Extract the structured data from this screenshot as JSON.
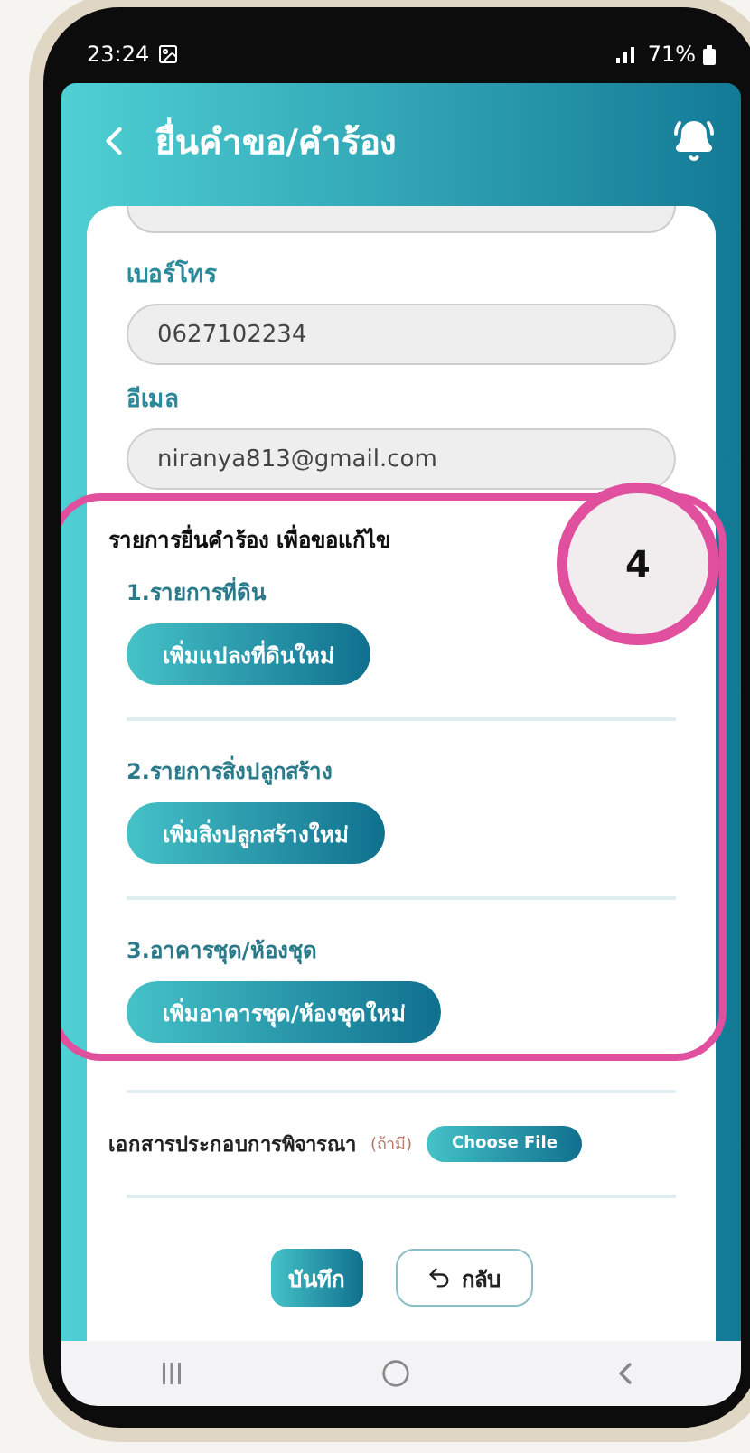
{
  "status_bar": {
    "time": "23:24",
    "battery": "71%"
  },
  "header": {
    "title": "ยื่นคำขอ/คำร้อง"
  },
  "form": {
    "fields": [
      {
        "label": "เบอร์โทร",
        "value": "0627102234"
      },
      {
        "label": "อีเมล",
        "value": "niranya813@gmail.com"
      }
    ],
    "section_title": "รายการยื่นคำร้อง เพื่อขอแก้ไข",
    "groups": [
      {
        "title": "1.รายการที่ดิน",
        "button": "เพิ่มแปลงที่ดินใหม่"
      },
      {
        "title": "2.รายการสิ่งปลูกสร้าง",
        "button": "เพิ่มสิ่งปลูกสร้างใหม่"
      },
      {
        "title": "3.อาคารชุด/ห้องชุด",
        "button": "เพิ่มอาคารชุด/ห้องชุดใหม่"
      }
    ],
    "attachment": {
      "label": "เอกสารประกอบการพิจารณา",
      "hint": "(ถ้ามี)",
      "button": "Choose File"
    },
    "actions": {
      "save": "บันทึก",
      "back": "กลับ"
    }
  },
  "annotation": {
    "number": "4"
  }
}
